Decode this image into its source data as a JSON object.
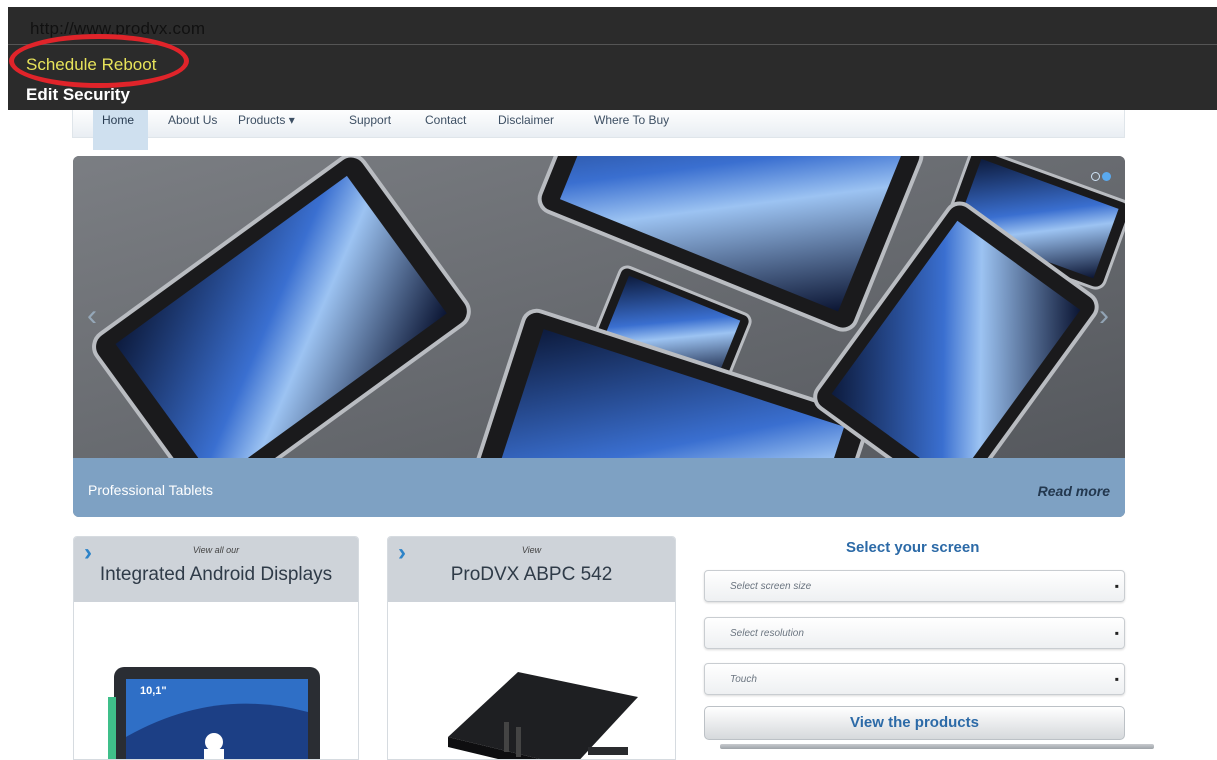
{
  "browser": {
    "url": "http://www.prodvx.com"
  },
  "context_menu": {
    "items": [
      {
        "label": "Schedule Reboot"
      },
      {
        "label": "Edit Security"
      }
    ]
  },
  "nav": {
    "items": [
      {
        "label": "Home"
      },
      {
        "label": "About Us"
      },
      {
        "label": "Products ▾"
      },
      {
        "label": "Support"
      },
      {
        "label": "Contact"
      },
      {
        "label": "Disclaimer"
      },
      {
        "label": "Where To Buy"
      }
    ]
  },
  "hero": {
    "caption": "Professional Tablets",
    "read_more": "Read more"
  },
  "cards": [
    {
      "small": "View all our",
      "title": "Integrated Android Displays",
      "screen_text": "10,1\""
    },
    {
      "small": "View",
      "title": "ProDVX ABPC 542"
    }
  ],
  "selector": {
    "title": "Select your screen",
    "options": [
      {
        "label": "Select screen size"
      },
      {
        "label": "Select resolution"
      },
      {
        "label": "Touch"
      }
    ],
    "button": "View the products"
  },
  "colors": {
    "highlight_circle": "#e0242a",
    "menu_highlight_text": "#e7e35a",
    "accent_blue": "#2c6aa7",
    "caption_bar": "#7ea1c3"
  },
  "icons": {
    "caret": "▪",
    "chevron": "›"
  }
}
